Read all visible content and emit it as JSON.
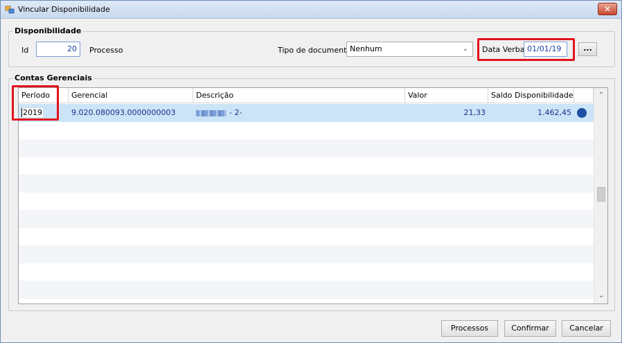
{
  "window": {
    "title": "Vincular Disponibilidade",
    "close_symbol": "✕"
  },
  "disponibilidade": {
    "group_title": "Disponibilidade",
    "id_label": "Id",
    "id_value": "20",
    "processo_label": "Processo",
    "tipo_label": "Tipo de documento",
    "tipo_value": "Nenhum",
    "data_verba_label": "Data Verba",
    "data_verba_value": "01/01/19",
    "ellipsis_label": "..."
  },
  "contas": {
    "group_title": "Contas Gerenciais",
    "columns": [
      "Período",
      "Gerencial",
      "Descrição",
      "Valor",
      "Saldo Disponibilidade"
    ],
    "rows": [
      {
        "periodo": "2019",
        "gerencial": "9.020.080093.0000000003",
        "descricao": "- 2-",
        "valor": "21,33",
        "saldo": "1.462,45"
      }
    ]
  },
  "buttons": {
    "processos": "Processos",
    "confirmar": "Confirmar",
    "cancelar": "Cancelar"
  },
  "colors": {
    "selected_row": "#cce4f7",
    "highlight_box": "#e2121c",
    "status_dot": "#1f4fa3"
  }
}
